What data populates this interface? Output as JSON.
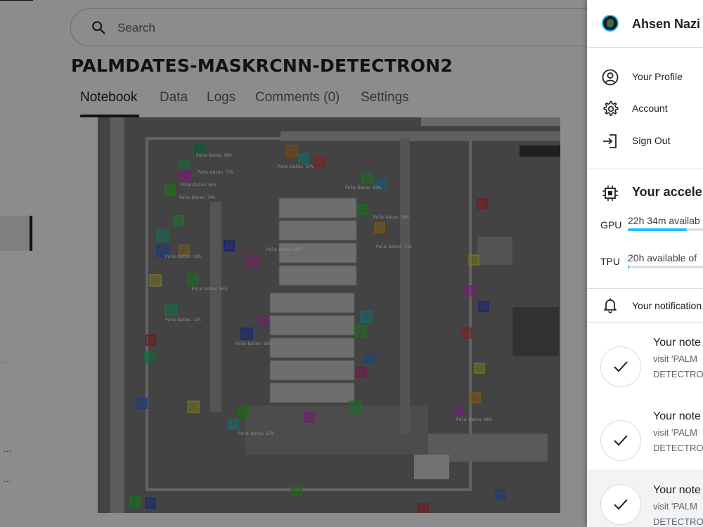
{
  "search": {
    "placeholder": "Search"
  },
  "notebook": {
    "title": "PALMDATES-MASKRCNN-DETECTRON2",
    "tabs": [
      {
        "label": "Notebook",
        "active": true
      },
      {
        "label": "Data"
      },
      {
        "label": "Logs"
      },
      {
        "label": "Comments (0)"
      },
      {
        "label": "Settings"
      }
    ],
    "figure_labels": [
      "Palm-Dates 98%",
      "Palm-Dates 73%",
      "Palm-Dates 85%",
      "Palm-Dates 57%",
      "Palm-Dates 79%",
      "Palm-Dates 82%",
      "Palm-Dates 87%",
      "Palm-Dates 95%",
      "Palm-Dates 93%",
      "Palm-Dates 71%",
      "Palm-Dates 64%",
      "Palm-Dates 72%",
      "Palm-Dates 96%",
      "Palm-Dates 67%",
      "Palm-Dates 86%"
    ]
  },
  "left_nav": {
    "ellipsis_1": "...",
    "ellipsis_2": "..."
  },
  "panel": {
    "user_name": "Ahsen Nazi",
    "menu": [
      {
        "label": "Your Profile",
        "icon": "profile-icon"
      },
      {
        "label": "Account",
        "icon": "gear-icon"
      },
      {
        "label": "Sign Out",
        "icon": "sign-out-icon"
      }
    ],
    "accelerators": {
      "title": "Your accele",
      "gpu": {
        "label": "GPU",
        "text": "22h 34m availab",
        "fraction": 0.7
      },
      "tpu": {
        "label": "TPU",
        "text": "20h available of",
        "fraction": 0.02
      }
    },
    "notifications": {
      "title": "Your notification",
      "items": [
        {
          "title": "Your note",
          "line1": "visit 'PALM",
          "line2": "DETECTRO"
        },
        {
          "title": "Your note",
          "line1": "visit 'PALM",
          "line2": "DETECTRO"
        },
        {
          "title": "Your note",
          "line1": "visit 'PALM",
          "line2": "DETECTRO"
        }
      ]
    }
  },
  "colors": {
    "accent": "#20beff",
    "overlay": "#000000",
    "text": "#202124"
  }
}
